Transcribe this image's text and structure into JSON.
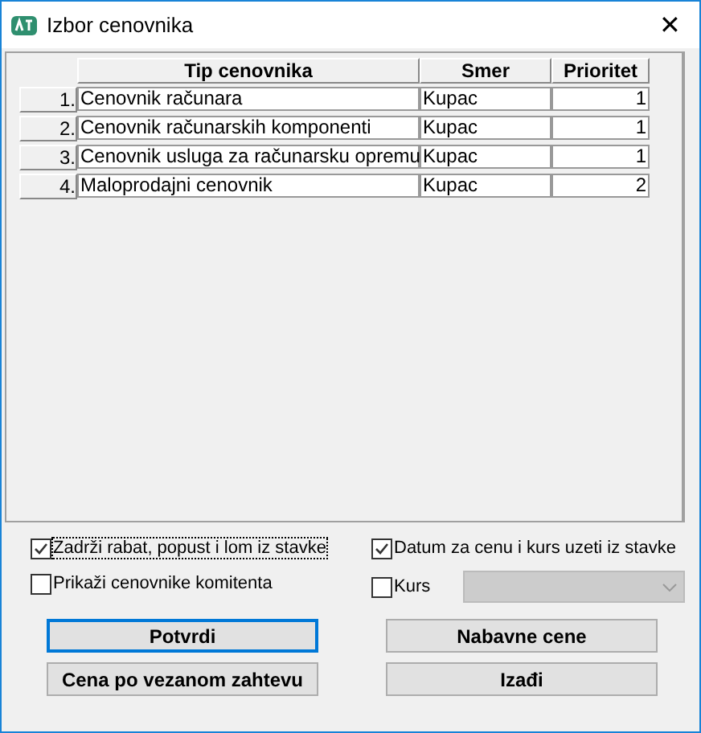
{
  "window": {
    "title": "Izbor cenovnika",
    "close": "✕"
  },
  "table": {
    "columns": [
      "Tip cenovnika",
      "Smer",
      "Prioritet"
    ],
    "rows": [
      {
        "index": "1.",
        "cells": [
          "Cenovnik računara",
          "Kupac",
          "1"
        ]
      },
      {
        "index": "2.",
        "cells": [
          "Cenovnik računarskih komponenti",
          "Kupac",
          "1"
        ]
      },
      {
        "index": "3.",
        "cells": [
          "Cenovnik usluga za računarsku opremu",
          "Kupac",
          "1"
        ]
      },
      {
        "index": "4.",
        "cells": [
          "Maloprodajni cenovnik",
          "Kupac",
          "2"
        ]
      }
    ]
  },
  "options_left": [
    {
      "label": "Zadrži rabat, popust i lom iz stavke",
      "checked": true,
      "focused": true
    },
    {
      "label": "Prikaži cenovnike komitenta",
      "checked": false,
      "focused": false
    }
  ],
  "options_right": [
    {
      "label": "Datum za cenu i kurs uzeti iz stavke",
      "checked": true
    },
    {
      "label": "Kurs",
      "checked": false
    }
  ],
  "kurs_select": {
    "disabled": true
  },
  "buttons_left": [
    {
      "label": "Potvrdi",
      "default": true
    },
    {
      "label": "Cena po vezanom zahtevu",
      "default": false
    }
  ],
  "buttons_right": [
    {
      "label": "Nabavne cene",
      "default": false
    },
    {
      "label": "Izađi",
      "default": false
    }
  ]
}
